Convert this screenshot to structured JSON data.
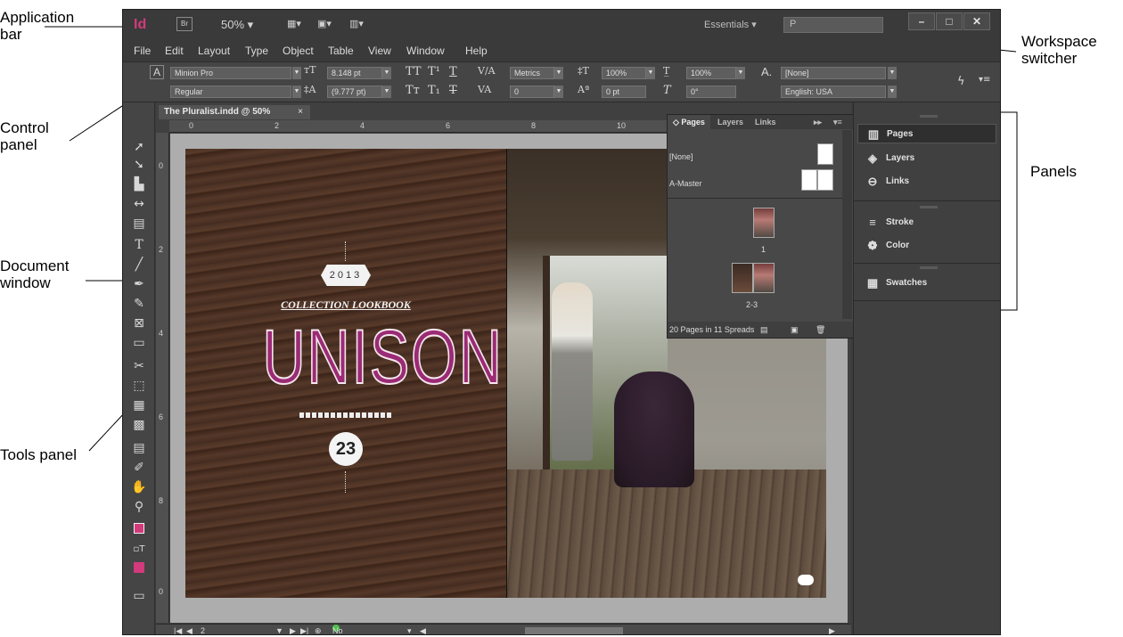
{
  "callouts": {
    "application_bar": "Application\nbar",
    "control_panel": "Control\npanel",
    "document_window": "Document\nwindow",
    "tools_panel": "Tools panel",
    "workspace_switcher": "Workspace\nswitcher",
    "panels": "Panels"
  },
  "appbar": {
    "logo": "Id",
    "bridge": "Br",
    "zoom": "50% ▾",
    "workspace": "Essentials ▾",
    "search_placeholder": "Ρ",
    "win_minimize": "–",
    "win_restore": "□",
    "win_close": "✕"
  },
  "menu": [
    "File",
    "Edit",
    "Layout",
    "Type",
    "Object",
    "Table",
    "View",
    "Window",
    "Help"
  ],
  "control": {
    "font": "Minion Pro",
    "style": "Regular",
    "size": "8.148 pt",
    "leading": "(9.777 pt)",
    "kerning": "Metrics",
    "tracking": "0",
    "vscale": "100%",
    "hscale": "100%",
    "baseline": "0 pt",
    "skew": "0°",
    "charstyle": "[None]",
    "language": "English: USA"
  },
  "document": {
    "tab_title": "The Pluralist.indd @ 50%",
    "tab_close": "×",
    "ruler_h": [
      "0",
      "2",
      "4",
      "6",
      "8",
      "10"
    ],
    "ruler_v": [
      "0",
      "2",
      "4",
      "6",
      "8",
      "0"
    ],
    "year": "2013",
    "collection": "COLLECTION LOOKBOOK",
    "headline": "UNISON",
    "number": "23",
    "page_field": "2",
    "status": "No errors"
  },
  "pages_panel": {
    "tabs": [
      "◇ Pages",
      "Layers",
      "Links"
    ],
    "master_none": "[None]",
    "master_a": "A-Master",
    "page1_label": "1",
    "page23_label": "2-3",
    "footer": "20 Pages in 11 Spreads"
  },
  "dock": {
    "items": [
      {
        "label": "Pages",
        "icon": "pages-icon"
      },
      {
        "label": "Layers",
        "icon": "layers-icon"
      },
      {
        "label": "Links",
        "icon": "links-icon"
      },
      {
        "label": "Stroke",
        "icon": "stroke-icon"
      },
      {
        "label": "Color",
        "icon": "color-icon"
      },
      {
        "label": "Swatches",
        "icon": "swatches-icon"
      }
    ]
  },
  "colors": {
    "accent_magenta": "#d23a7c",
    "ui_dark": "#3c3c3c"
  }
}
